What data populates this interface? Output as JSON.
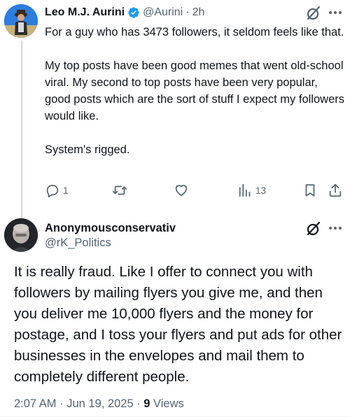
{
  "parent_post": {
    "author_name": "Leo M.J. Aurini",
    "handle": "@Aurini",
    "dot": "·",
    "time": "2h",
    "text": "For a guy who has 3473 followers, it seldom feels like that.\n\nMy top posts have been good memes that went old-school viral. My second to top posts have been very popular, good posts which are the sort of stuff I expect my followers would like.\n\nSystem's rigged.",
    "replies": "1",
    "views": "13",
    "icons": {
      "verified": "verified-badge-icon",
      "grok": "grok-icon",
      "more": "more-icon",
      "reply": "reply-icon",
      "repost": "repost-icon",
      "like": "like-icon",
      "views": "views-icon",
      "bookmark": "bookmark-icon",
      "share": "share-icon"
    }
  },
  "reply_post": {
    "author_name": "Anonymousconservativ",
    "handle": "@rK_Politics",
    "text": "It is really fraud. Like I offer to connect you with followers by mailing flyers you give me, and then you deliver me 10,000 flyers and the money for postage, and I toss your flyers and put ads for other businesses in the envelopes and mail them to completely different people.",
    "timestamp": "2:07 AM · Jun 19, 2025 · ",
    "views_count": "9",
    "views_label": " Views"
  },
  "colors": {
    "accent": "#1d9bf0",
    "text_primary": "#0f1419",
    "text_secondary": "#536471",
    "divider": "#cfd9de"
  }
}
